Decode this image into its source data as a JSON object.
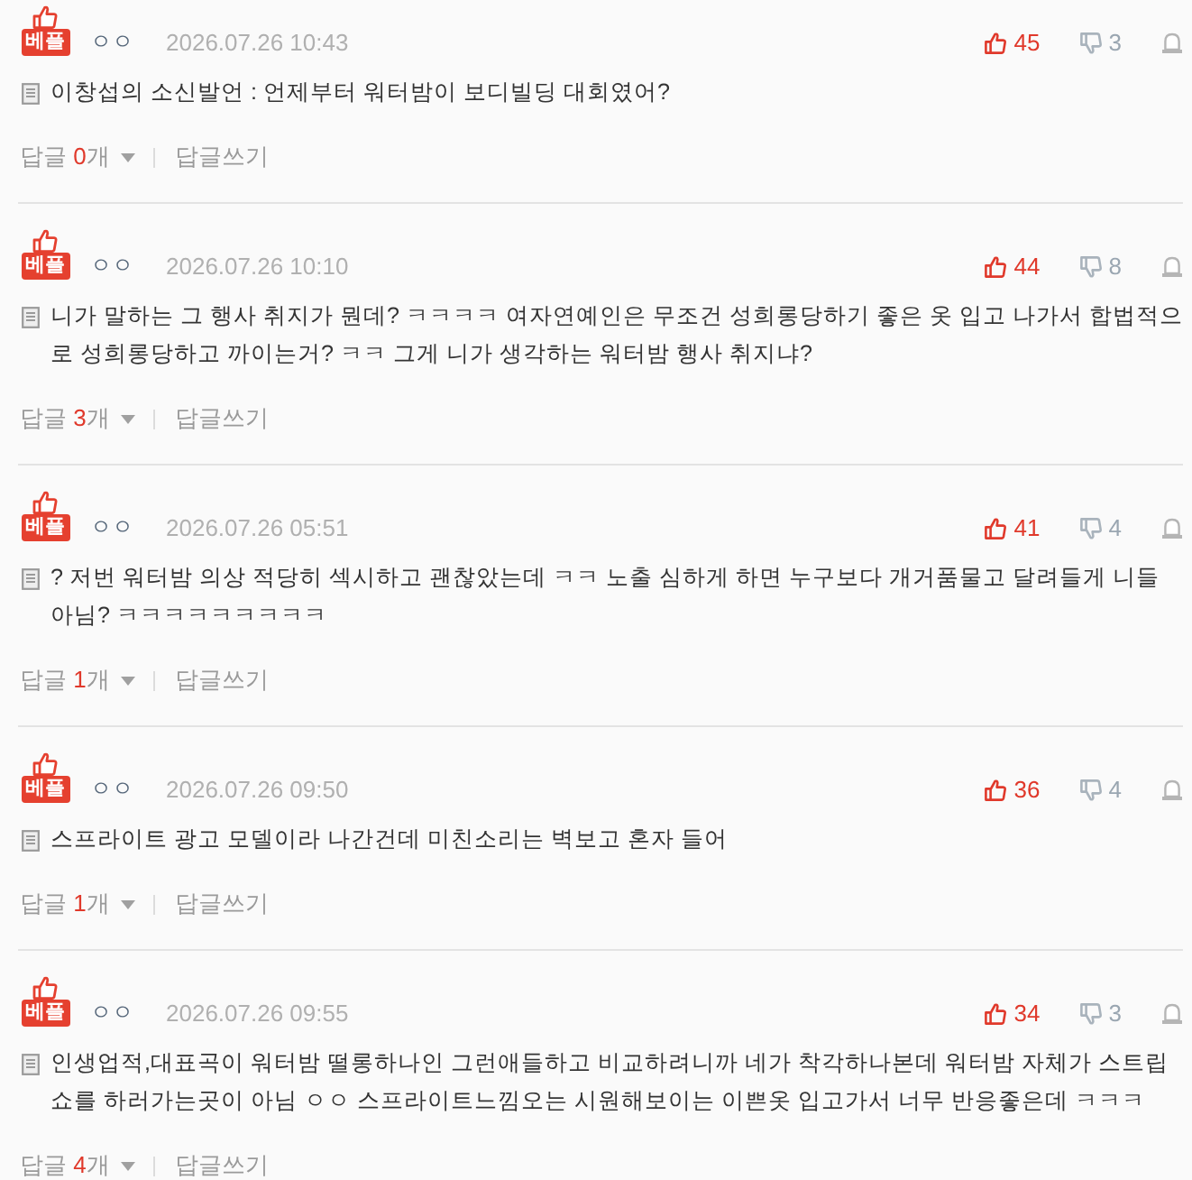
{
  "comments": [
    {
      "badge": "베플",
      "user": "ㅇㅇ",
      "date": "2026.07.26 10:43",
      "likes": "45",
      "dislikes": "3",
      "text": "이창섭의 소신발언 : 언제부터 워터밤이 보디빌딩 대회였어?",
      "reply_label": "답글",
      "reply_count": "0",
      "reply_unit": "개",
      "write_reply": "답글쓰기"
    },
    {
      "badge": "베플",
      "user": "ㅇㅇ",
      "date": "2026.07.26 10:10",
      "likes": "44",
      "dislikes": "8",
      "text": "니가 말하는 그 행사 취지가 뭔데? ㅋㅋㅋㅋ 여자연예인은 무조건 성희롱당하기 좋은 옷 입고 나가서 합법적으로 성희롱당하고 까이는거? ㅋㅋ 그게 니가 생각하는 워터밤 행사 취지냐?",
      "reply_label": "답글",
      "reply_count": "3",
      "reply_unit": "개",
      "write_reply": "답글쓰기"
    },
    {
      "badge": "베플",
      "user": "ㅇㅇ",
      "date": "2026.07.26 05:51",
      "likes": "41",
      "dislikes": "4",
      "text": "? 저번 워터밤 의상 적당히 섹시하고 괜찮았는데 ㅋㅋ 노출 심하게 하면 누구보다 개거품물고 달려들게 니들 아님? ㅋㅋㅋㅋㅋㅋㅋㅋㅋ",
      "reply_label": "답글",
      "reply_count": "1",
      "reply_unit": "개",
      "write_reply": "답글쓰기"
    },
    {
      "badge": "베플",
      "user": "ㅇㅇ",
      "date": "2026.07.26 09:50",
      "likes": "36",
      "dislikes": "4",
      "text": "스프라이트 광고 모델이라 나간건데 미친소리는 벽보고 혼자 들어",
      "reply_label": "답글",
      "reply_count": "1",
      "reply_unit": "개",
      "write_reply": "답글쓰기"
    },
    {
      "badge": "베플",
      "user": "ㅇㅇ",
      "date": "2026.07.26 09:55",
      "likes": "34",
      "dislikes": "3",
      "text": "인생업적,대표곡이 워터밤 떨롱하나인 그런애들하고 비교하려니까 네가 착각하나본데 워터밤 자체가 스트립쇼를 하러가는곳이 아님 ㅇㅇ 스프라이트느낌오는 시원해보이는 이쁜옷 입고가서 너무 반응좋은데 ㅋㅋㅋ",
      "reply_label": "답글",
      "reply_count": "4",
      "reply_unit": "개",
      "write_reply": "답글쓰기"
    }
  ]
}
